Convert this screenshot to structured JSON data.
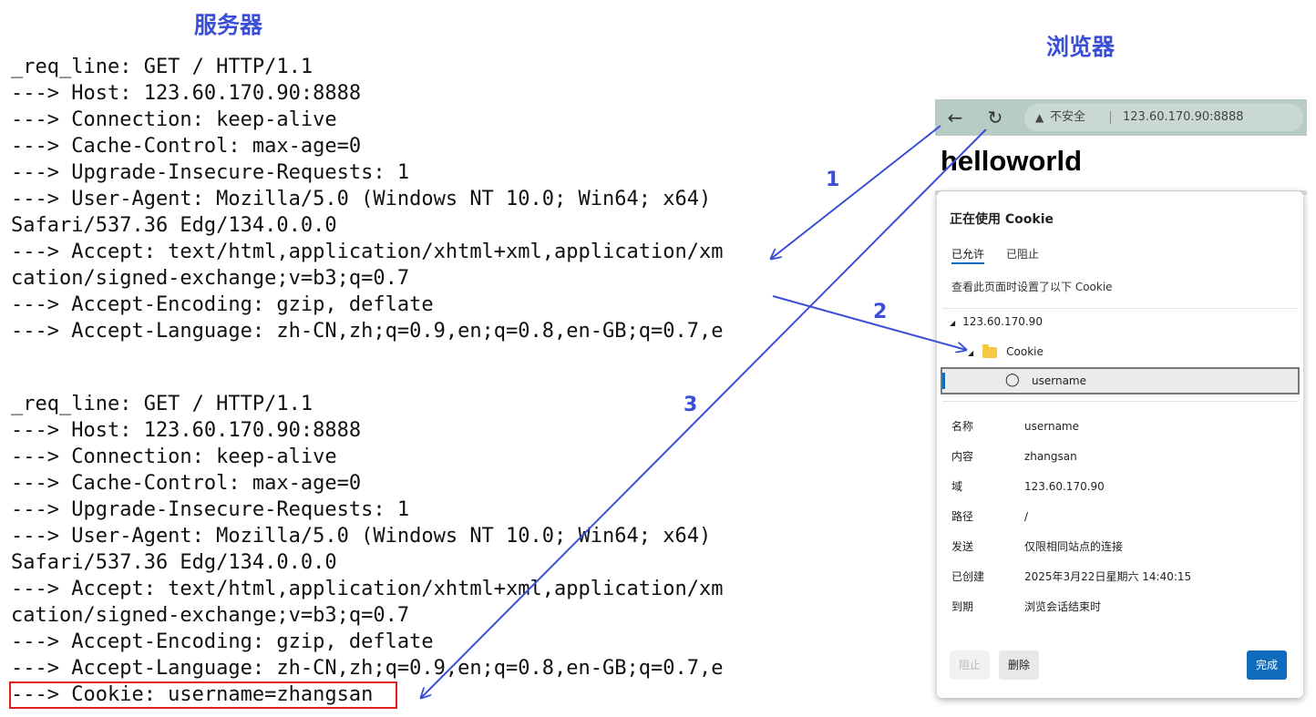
{
  "headings": {
    "server": "服务器",
    "browser": "浏览器"
  },
  "server_log": {
    "request1": [
      "_req_line: GET / HTTP/1.1",
      "---> Host: 123.60.170.90:8888",
      "---> Connection: keep-alive",
      "---> Cache-Control: max-age=0",
      "---> Upgrade-Insecure-Requests: 1",
      "---> User-Agent: Mozilla/5.0 (Windows NT 10.0; Win64; x64)",
      "Safari/537.36 Edg/134.0.0.0",
      "---> Accept: text/html,application/xhtml+xml,application/xm",
      "cation/signed-exchange;v=b3;q=0.7",
      "---> Accept-Encoding: gzip, deflate",
      "---> Accept-Language: zh-CN,zh;q=0.9,en;q=0.8,en-GB;q=0.7,e"
    ],
    "request2": [
      "_req_line: GET / HTTP/1.1",
      "---> Host: 123.60.170.90:8888",
      "---> Connection: keep-alive",
      "---> Cache-Control: max-age=0",
      "---> Upgrade-Insecure-Requests: 1",
      "---> User-Agent: Mozilla/5.0 (Windows NT 10.0; Win64; x64)",
      "Safari/537.36 Edg/134.0.0.0",
      "---> Accept: text/html,application/xhtml+xml,application/xm",
      "cation/signed-exchange;v=b3;q=0.7",
      "---> Accept-Encoding: gzip, deflate",
      "---> Accept-Language: zh-CN,zh;q=0.9,en;q=0.8,en-GB;q=0.7,e",
      "---> Cookie: username=zhangsan"
    ]
  },
  "browser": {
    "toolbar": {
      "back_icon": "arrow-left-icon",
      "reload_icon": "refresh-icon",
      "warning_icon": "warning-triangle-icon",
      "insecure_label": "不安全",
      "url": "123.60.170.90:8888"
    },
    "page_heading": "helloworld",
    "cookie_dialog": {
      "title": "正在使用 Cookie",
      "tabs": [
        "已允许",
        "已阻止"
      ],
      "active_tab": "已允许",
      "description": "查看此页面时设置了以下 Cookie",
      "tree": {
        "domain": "123.60.170.90",
        "folder": "Cookie",
        "cookie": "username"
      },
      "details": [
        {
          "key": "名称",
          "value": "username"
        },
        {
          "key": "内容",
          "value": "zhangsan"
        },
        {
          "key": "域",
          "value": "123.60.170.90"
        },
        {
          "key": "路径",
          "value": "/"
        },
        {
          "key": "发送",
          "value": "仅限相同站点的连接"
        },
        {
          "key": "已创建",
          "value": "2025年3月22日星期六 14:40:15"
        },
        {
          "key": "到期",
          "value": "浏览会话结束时"
        }
      ],
      "buttons": {
        "block": "阻止",
        "delete": "删除",
        "done": "完成"
      }
    }
  },
  "annotations": {
    "arrow1": "1",
    "arrow2": "2",
    "arrow3": "3"
  },
  "colors": {
    "annotation": "#3b4fd6",
    "highlight_box": "#e02020",
    "primary_button": "#0f6cbd"
  }
}
